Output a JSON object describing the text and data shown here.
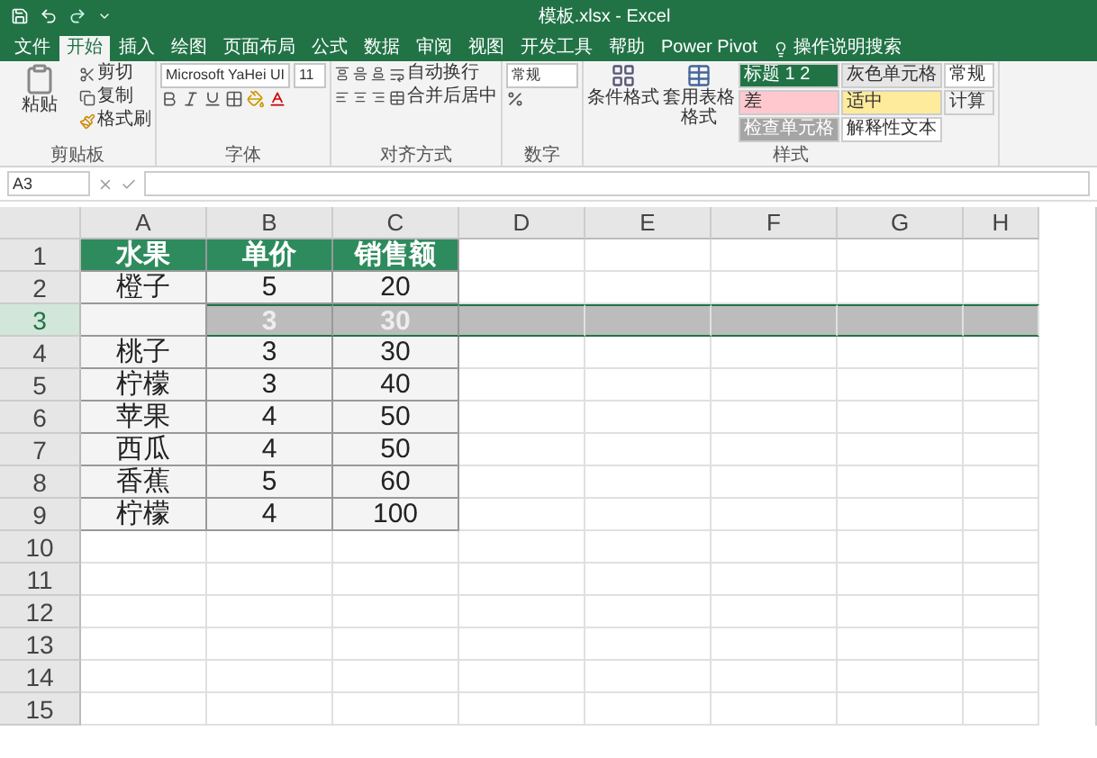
{
  "window": {
    "title": "模板.xlsx - Excel"
  },
  "tabs": [
    {
      "label": "文件",
      "selected": false
    },
    {
      "label": "开始",
      "selected": true
    },
    {
      "label": "插入",
      "selected": false
    },
    {
      "label": "绘图",
      "selected": false
    },
    {
      "label": "页面布局",
      "selected": false
    },
    {
      "label": "公式",
      "selected": false
    },
    {
      "label": "数据",
      "selected": false
    },
    {
      "label": "审阅",
      "selected": false
    },
    {
      "label": "视图",
      "selected": false
    },
    {
      "label": "开发工具",
      "selected": false
    },
    {
      "label": "帮助",
      "selected": false
    },
    {
      "label": "Power Pivot",
      "selected": false
    }
  ],
  "search": {
    "placeholder": "操作说明搜索"
  },
  "ribbon": {
    "clipboard": {
      "label": "剪贴板",
      "paste": "粘贴",
      "cut": "剪切",
      "copy": "复制",
      "format_painter": "格式刷"
    },
    "font": {
      "label": "字体",
      "font_name": "Microsoft YaHei UI",
      "font_size": "11"
    },
    "alignment": {
      "label": "对齐方式",
      "wrap": "自动换行",
      "merge": "合并后居中"
    },
    "number": {
      "label": "数字",
      "format": "常规"
    },
    "styles": {
      "label": "样式",
      "conditional": "条件格式",
      "table": "套用表格格式",
      "cells": [
        {
          "text": "标题 1 2",
          "color": "#217346"
        },
        {
          "text": "灰色单元格",
          "color": "#e7e6e6"
        },
        {
          "text": "常规",
          "color": "#ffffff"
        },
        {
          "text": "差",
          "color": "#ffc7ce"
        },
        {
          "text": "适中",
          "color": "#ffeb9c"
        },
        {
          "text": "计算",
          "color": "#f2f2f2"
        },
        {
          "text": "检查单元格",
          "color": "#a5a5a5"
        },
        {
          "text": "解释性文本",
          "color": "#ffffff"
        }
      ]
    }
  },
  "formula_bar": {
    "name_box": "A3"
  },
  "sheet": {
    "columns": [
      "A",
      "B",
      "C",
      "D",
      "E",
      "F",
      "G",
      "H"
    ],
    "rows": [
      {
        "number": "1",
        "kind": "header",
        "selected": false,
        "cells": [
          "水果",
          "单价",
          "销售额"
        ]
      },
      {
        "number": "2",
        "kind": "data",
        "selected": false,
        "cells": [
          "橙子",
          "5",
          "20"
        ]
      },
      {
        "number": "3",
        "kind": "dragging",
        "selected": true,
        "cells": [
          "",
          "3",
          "30"
        ]
      },
      {
        "number": "4",
        "kind": "data",
        "selected": false,
        "cells": [
          "桃子",
          "3",
          "30"
        ]
      },
      {
        "number": "5",
        "kind": "data",
        "selected": false,
        "cells": [
          "柠檬",
          "3",
          "40"
        ]
      },
      {
        "number": "6",
        "kind": "data",
        "selected": false,
        "cells": [
          "苹果",
          "4",
          "50"
        ]
      },
      {
        "number": "7",
        "kind": "data",
        "selected": false,
        "cells": [
          "西瓜",
          "4",
          "50"
        ]
      },
      {
        "number": "8",
        "kind": "data",
        "selected": false,
        "cells": [
          "香蕉",
          "5",
          "60"
        ]
      },
      {
        "number": "9",
        "kind": "data",
        "selected": false,
        "cells": [
          "柠檬",
          "4",
          "100"
        ]
      },
      {
        "number": "10",
        "kind": "empty",
        "selected": false,
        "cells": []
      },
      {
        "number": "11",
        "kind": "empty",
        "selected": false,
        "cells": []
      },
      {
        "number": "12",
        "kind": "empty",
        "selected": false,
        "cells": []
      },
      {
        "number": "13",
        "kind": "empty",
        "selected": false,
        "cells": []
      },
      {
        "number": "14",
        "kind": "empty",
        "selected": false,
        "cells": []
      },
      {
        "number": "15",
        "kind": "empty",
        "selected": false,
        "cells": []
      }
    ]
  }
}
